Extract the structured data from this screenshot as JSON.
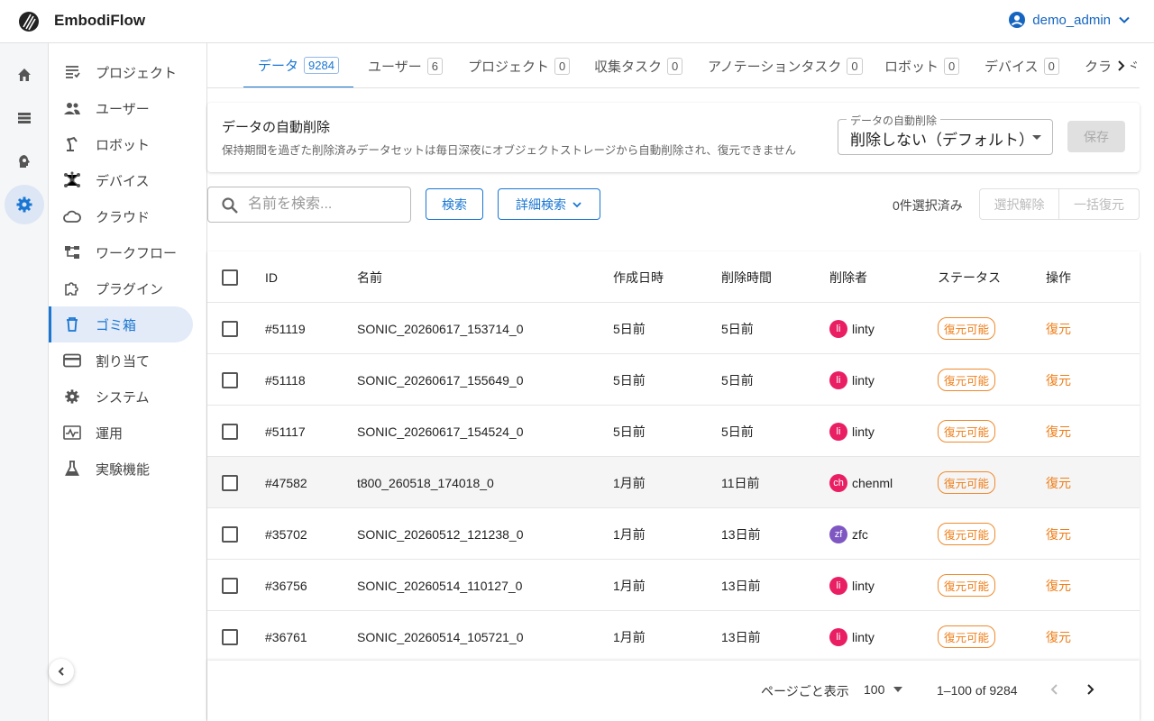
{
  "app": {
    "title": "EmbodiFlow",
    "logo_icon": "embodiflow-logo"
  },
  "user": {
    "name": "demo_admin"
  },
  "rail": [
    {
      "icon": "home-icon"
    },
    {
      "icon": "storage-icon"
    },
    {
      "icon": "psychology-icon"
    },
    {
      "icon": "settings-icon",
      "active": true
    }
  ],
  "sidebar": {
    "items": [
      {
        "label": "プロジェクト",
        "icon": "project-list-icon"
      },
      {
        "label": "ユーザー",
        "icon": "people-icon"
      },
      {
        "label": "ロボット",
        "icon": "robot-arm-icon"
      },
      {
        "label": "デバイス",
        "icon": "device-hub-icon"
      },
      {
        "label": "クラウド",
        "icon": "cloud-icon"
      },
      {
        "label": "ワークフロー",
        "icon": "workflow-icon"
      },
      {
        "label": "プラグイン",
        "icon": "plugin-icon"
      },
      {
        "label": "ゴミ箱",
        "icon": "trash-icon",
        "active": true
      },
      {
        "label": "割り当て",
        "icon": "credit-card-icon"
      },
      {
        "label": "システム",
        "icon": "gear-icon"
      },
      {
        "label": "運用",
        "icon": "monitoring-icon"
      },
      {
        "label": "実験機能",
        "icon": "flask-icon"
      }
    ]
  },
  "tabs": [
    {
      "label": "データ",
      "count": "9284",
      "active": true
    },
    {
      "label": "ユーザー",
      "count": "6"
    },
    {
      "label": "プロジェクト",
      "count": "0"
    },
    {
      "label": "収集タスク",
      "count": "0"
    },
    {
      "label": "アノテーションタスク",
      "count": "0"
    },
    {
      "label": "ロボット",
      "count": "0"
    },
    {
      "label": "デバイス",
      "count": "0"
    },
    {
      "label": "クラウド",
      "count": ""
    }
  ],
  "auto_delete": {
    "title": "データの自動削除",
    "description": "保持期間を過ぎた削除済みデータセットは毎日深夜にオブジェクトストレージから自動削除され、復元できません",
    "select_label": "データの自動削除",
    "select_value": "削除しない（デフォルト）",
    "save_label": "保存"
  },
  "toolbar": {
    "search_placeholder": "名前を検索...",
    "search_button": "検索",
    "advanced_search": "詳細検索",
    "selected_count": "0件選択済み",
    "deselect": "選択解除",
    "bulk_restore": "一括復元"
  },
  "table": {
    "headers": {
      "id": "ID",
      "name": "名前",
      "created": "作成日時",
      "deleted_time": "削除時間",
      "deleted_by": "削除者",
      "status": "ステータス",
      "actions": "操作"
    },
    "rows": [
      {
        "id": "#51119",
        "name": "SONIC_20260617_153714_0",
        "created": "5日前",
        "deleted": "5日前",
        "user_initials": "li",
        "user": "linty",
        "user_color": "#e91e63",
        "status": "復元可能",
        "action": "復元"
      },
      {
        "id": "#51118",
        "name": "SONIC_20260617_155649_0",
        "created": "5日前",
        "deleted": "5日前",
        "user_initials": "li",
        "user": "linty",
        "user_color": "#e91e63",
        "status": "復元可能",
        "action": "復元"
      },
      {
        "id": "#51117",
        "name": "SONIC_20260617_154524_0",
        "created": "5日前",
        "deleted": "5日前",
        "user_initials": "li",
        "user": "linty",
        "user_color": "#e91e63",
        "status": "復元可能",
        "action": "復元"
      },
      {
        "id": "#47582",
        "name": "t800_260518_174018_0",
        "created": "1月前",
        "deleted": "11日前",
        "user_initials": "ch",
        "user": "chenml",
        "user_color": "#e91e63",
        "status": "復元可能",
        "action": "復元"
      },
      {
        "id": "#35702",
        "name": "SONIC_20260512_121238_0",
        "created": "1月前",
        "deleted": "13日前",
        "user_initials": "zf",
        "user": "zfc",
        "user_color": "#7e57c2",
        "status": "復元可能",
        "action": "復元"
      },
      {
        "id": "#36756",
        "name": "SONIC_20260514_110127_0",
        "created": "1月前",
        "deleted": "13日前",
        "user_initials": "li",
        "user": "linty",
        "user_color": "#e91e63",
        "status": "復元可能",
        "action": "復元"
      },
      {
        "id": "#36761",
        "name": "SONIC_20260514_105721_0",
        "created": "1月前",
        "deleted": "13日前",
        "user_initials": "li",
        "user": "linty",
        "user_color": "#e91e63",
        "status": "復元可能",
        "action": "復元"
      }
    ]
  },
  "pagination": {
    "per_page_label": "ページごと表示",
    "per_page": "100",
    "range": "1–100 of 9284"
  }
}
